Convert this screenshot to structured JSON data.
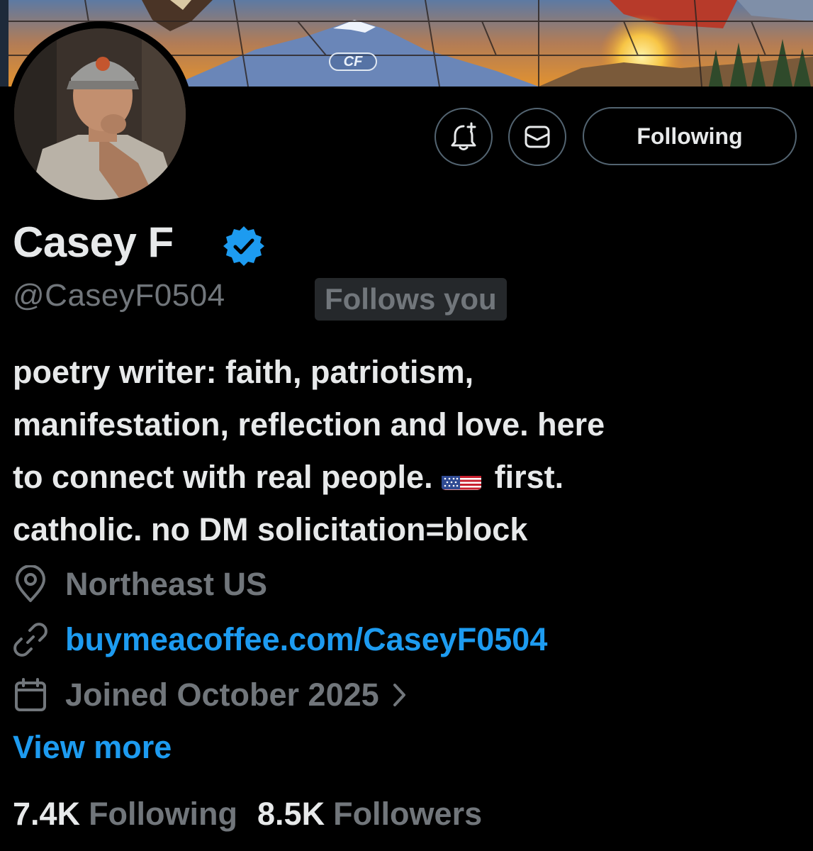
{
  "banner": {
    "badge_text": "CF"
  },
  "profile": {
    "display_name": "Casey F",
    "verified": true,
    "handle": "@CaseyF0504",
    "follows_you_label": "Follows you"
  },
  "actions": {
    "notify_icon": "bell-plus-icon",
    "message_icon": "envelope-icon",
    "following_label": "Following"
  },
  "bio": {
    "line1": "poetry writer: faith, patriotism,",
    "line2": "manifestation, reflection and love. here",
    "line3_before_flag": "to connect with real people.",
    "flag": "us-flag-emoji",
    "line3_after_flag": "first.",
    "line4": "catholic. no DM solicitation=block"
  },
  "meta": {
    "location": "Northeast US",
    "location_icon": "location-pin-icon",
    "link": "buymeacoffee.com/CaseyF0504",
    "link_icon": "link-icon",
    "joined": "Joined October 2025",
    "joined_icon": "calendar-icon"
  },
  "view_more_label": "View more",
  "stats": {
    "following_count": "7.4K",
    "following_label": "Following",
    "followers_count": "8.5K",
    "followers_label": "Followers"
  },
  "colors": {
    "background": "#000000",
    "primary_text": "#e7e9ea",
    "secondary_text": "#71767b",
    "accent": "#1d9bf0",
    "border": "#536471"
  }
}
